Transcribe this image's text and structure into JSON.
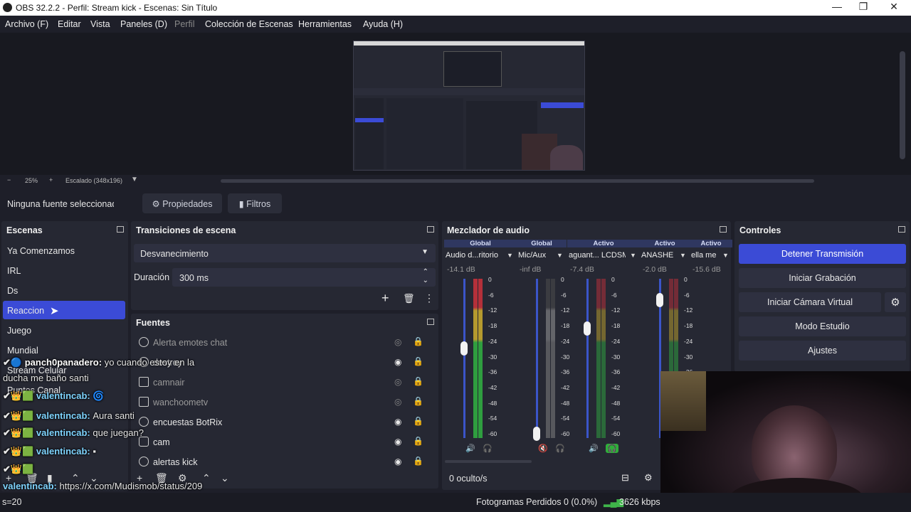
{
  "window": {
    "title": "OBS 32.2.2 - Perfil: Stream kick - Escenas: Sin Título"
  },
  "menu": [
    "Archivo (F)",
    "Editar",
    "Vista",
    "Paneles (D)",
    "Perfil",
    "Colección de Escenas",
    "Herramientas",
    "Ayuda (H)"
  ],
  "zoombar": {
    "minus": "−",
    "zoom": "25%",
    "plus": "+",
    "scale": "Escalado (348x196)"
  },
  "source_toolbar": {
    "no_source": "Ninguna fuente seleccionad",
    "properties": "Propiedades",
    "filters": "Filtros"
  },
  "scenes": {
    "title": "Escenas",
    "items": [
      "Ya Comenzamos",
      "IRL",
      "Ds",
      "Reaccion",
      "Juego",
      "Mundial",
      "Stream Celular",
      "Puntos Canal"
    ],
    "selected": "Reaccion"
  },
  "transitions": {
    "title": "Transiciones de escena",
    "type": "Desvanecimiento",
    "duration_label": "Duración",
    "duration_value": "300 ms"
  },
  "sources": {
    "title": "Fuentes",
    "items": [
      {
        "name": "Alerta emotes chat",
        "visible": false,
        "icon": "browser-icon"
      },
      {
        "name": "destroy",
        "visible": true,
        "icon": "browser-icon"
      },
      {
        "name": "camnair",
        "visible": false,
        "icon": "image-icon"
      },
      {
        "name": "wanchoometv",
        "visible": false,
        "icon": "image-icon"
      },
      {
        "name": "encuestas BotRix",
        "visible": true,
        "icon": "browser-icon"
      },
      {
        "name": "cam",
        "visible": true,
        "icon": "camera-icon"
      },
      {
        "name": "alertas kick",
        "visible": true,
        "icon": "browser-icon"
      }
    ]
  },
  "mixer": {
    "title": "Mezclador de audio",
    "channels": [
      {
        "tag": "Global",
        "name": "Audio d...ritorio",
        "db": "-14.1 dB",
        "level": 0.32,
        "muted": false
      },
      {
        "tag": "Global",
        "name": "Mic/Aux",
        "db": "-inf dB",
        "level": 0.0,
        "muted": true
      },
      {
        "tag": "Activo",
        "name": "aguant... LCDSM",
        "db": "-7.4 dB",
        "level": 0.0,
        "muted": false
      },
      {
        "tag": "Activo",
        "name": "ANASHE",
        "db": "-2.0 dB",
        "level": 0.0,
        "muted": false
      },
      {
        "tag": "Activo",
        "name": "ella me llan",
        "db": "-15.6 dB",
        "level": 0.0,
        "muted": false
      }
    ],
    "scale": [
      "0",
      "-6",
      "-12",
      "-18",
      "-24",
      "-30",
      "-36",
      "-42",
      "-48",
      "-54",
      "-60"
    ],
    "hidden": "0 oculto/s"
  },
  "controls": {
    "title": "Controles",
    "stop_stream": "Detener Transmisión",
    "start_record": "Iniciar Grabación",
    "virtual_cam": "Iniciar Cámara Virtual",
    "studio": "Modo Estudio",
    "settings": "Ajustes"
  },
  "chat": [
    {
      "user": "panch0panadero:",
      "msg": "yo cuando estoy en la"
    },
    {
      "user": "",
      "msg": "ducha me baño santi"
    },
    {
      "user": "valentincab:",
      "msg": ""
    },
    {
      "user": "valentincab:",
      "msg": "Aura santi"
    },
    {
      "user": "valentincab:",
      "msg": "que juegan?"
    },
    {
      "user": "valentincab:",
      "msg": ""
    },
    {
      "user": "valentincab:",
      "msg": "https://x.com/Mudismob/status/209"
    }
  ],
  "status": {
    "left": "s=20",
    "dropped": "Fotogramas Perdidos 0 (0.0%)",
    "bitrate": "3626 kbps"
  },
  "colors": {
    "accent": "#3b4bd6",
    "panel": "#262833",
    "bg": "#1e1f29"
  }
}
